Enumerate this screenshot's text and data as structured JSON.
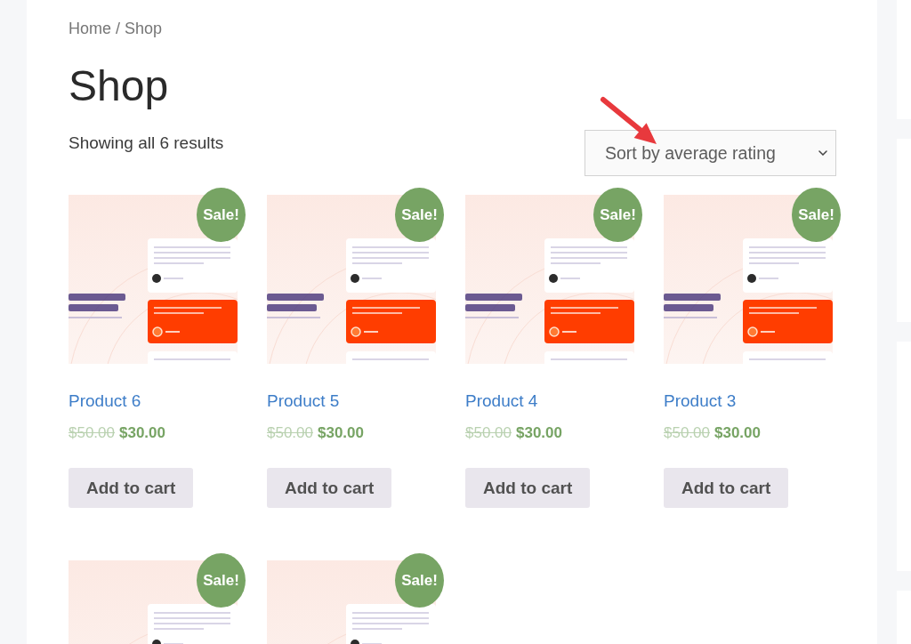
{
  "breadcrumb": {
    "items": [
      {
        "label": "Home"
      },
      {
        "label": "Shop"
      }
    ],
    "separator": "/"
  },
  "title": "Shop",
  "result_count": "Showing all 6 results",
  "sort": {
    "value": "Sort by average rating"
  },
  "products": [
    {
      "badge": "Sale!",
      "name": "Product 6",
      "regular_price": "$50.00",
      "sale_price": "$30.00",
      "button": "Add to cart"
    },
    {
      "badge": "Sale!",
      "name": "Product 5",
      "regular_price": "$50.00",
      "sale_price": "$30.00",
      "button": "Add to cart"
    },
    {
      "badge": "Sale!",
      "name": "Product 4",
      "regular_price": "$50.00",
      "sale_price": "$30.00",
      "button": "Add to cart"
    },
    {
      "badge": "Sale!",
      "name": "Product 3",
      "regular_price": "$50.00",
      "sale_price": "$30.00",
      "button": "Add to cart"
    },
    {
      "badge": "Sale!"
    },
    {
      "badge": "Sale!"
    }
  ]
}
